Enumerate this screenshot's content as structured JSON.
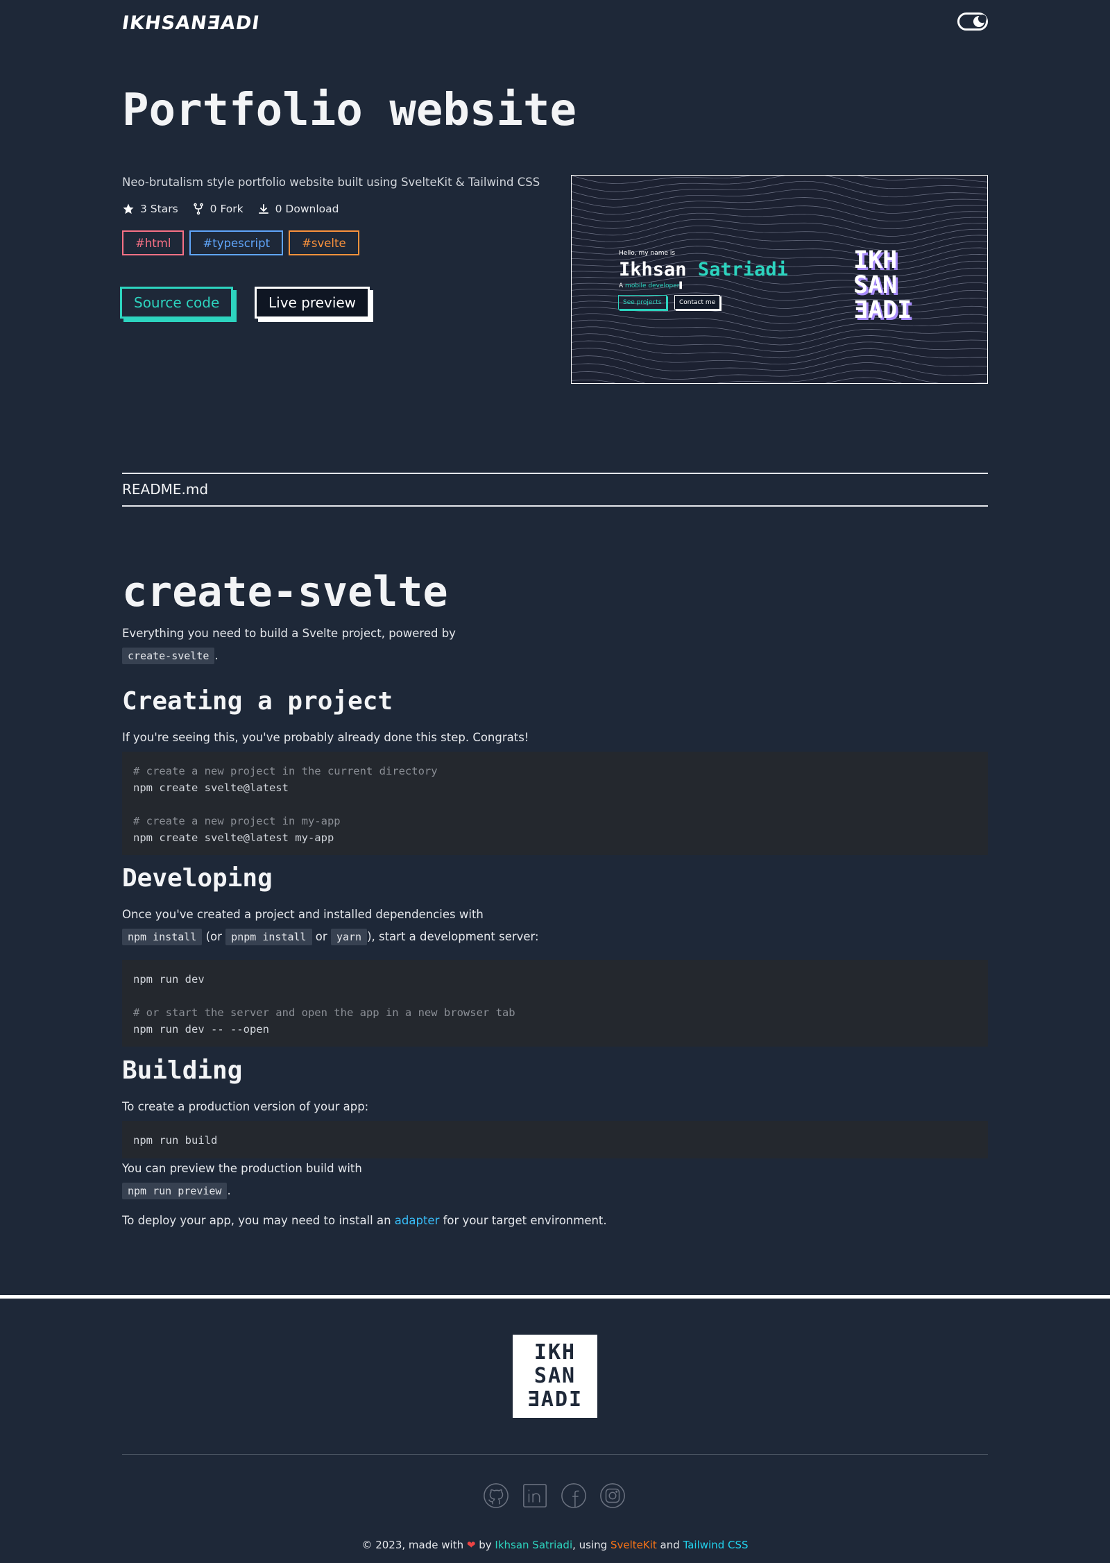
{
  "header": {
    "logo": "IKHSANƎADI"
  },
  "project": {
    "title": "Portfolio website",
    "description": "Neo-brutalism style portfolio website built using SvelteKit & Tailwind CSS",
    "stats": {
      "stars": "3 Stars",
      "forks": "0 Fork",
      "downloads": "0 Download"
    },
    "tags": [
      {
        "label": "#html",
        "color": "#f87185"
      },
      {
        "label": "#typescript",
        "color": "#60a5fa"
      },
      {
        "label": "#svelte",
        "color": "#fb923c"
      }
    ],
    "buttons": {
      "source": "Source code",
      "live": "Live preview"
    },
    "preview": {
      "hello": "Hello, my name is",
      "first_name": "Ikhsan",
      "last_name": "Satriadi",
      "role_prefix": "A",
      "role": "mobile developer",
      "btn_projects": "See projects",
      "btn_contact": "Contact me",
      "logo_lines": [
        "IKH",
        "SAN",
        "ƎADI"
      ]
    }
  },
  "readme": {
    "label": "README.md",
    "h1": "create-svelte",
    "intro": "Everything you need to build a Svelte project, powered by",
    "intro_code": "create-svelte",
    "intro_end": ".",
    "sections": {
      "creating": {
        "title": "Creating a project",
        "text": "If you're seeing this, you've probably already done this step. Congrats!",
        "code": [
          {
            "text": "# create a new project in the current directory",
            "comment": true
          },
          {
            "text": "npm create svelte@latest",
            "comment": false
          },
          {
            "text": "",
            "comment": false
          },
          {
            "text": "# create a new project in my-app",
            "comment": true
          },
          {
            "text": "npm create svelte@latest my-app",
            "comment": false
          }
        ]
      },
      "developing": {
        "title": "Developing",
        "text1": "Once you've created a project and installed dependencies with",
        "code_npm": "npm install",
        "or_open": "(or",
        "code_pnpm": "pnpm install",
        "or": "or",
        "code_yarn": "yarn",
        "text2": "), start a development server:",
        "code": [
          {
            "text": "npm run dev",
            "comment": false
          },
          {
            "text": "",
            "comment": false
          },
          {
            "text": "# or start the server and open the app in a new browser tab",
            "comment": true
          },
          {
            "text": "npm run dev -- --open",
            "comment": false
          }
        ]
      },
      "building": {
        "title": "Building",
        "text": "To create a production version of your app:",
        "code": "npm run build",
        "preview_text": "You can preview the production build with",
        "preview_code": "npm run preview",
        "preview_end": ".",
        "deploy_before": "To deploy your app, you may need to install an",
        "deploy_link": "adapter",
        "deploy_after": "for your target environment."
      }
    }
  },
  "footer": {
    "logo_lines": [
      "IKH",
      "SAN",
      "ƎADI"
    ],
    "socials": [
      "github-icon",
      "linkedin-icon",
      "facebook-icon",
      "instagram-icon"
    ],
    "copyright_prefix": "© 2023, made with",
    "heart": "❤",
    "by": "by",
    "author": "Ikhsan Satriadi",
    "using": ", using",
    "sveltekit": "SvelteKit",
    "and": "and",
    "tailwind": "Tailwind CSS"
  }
}
